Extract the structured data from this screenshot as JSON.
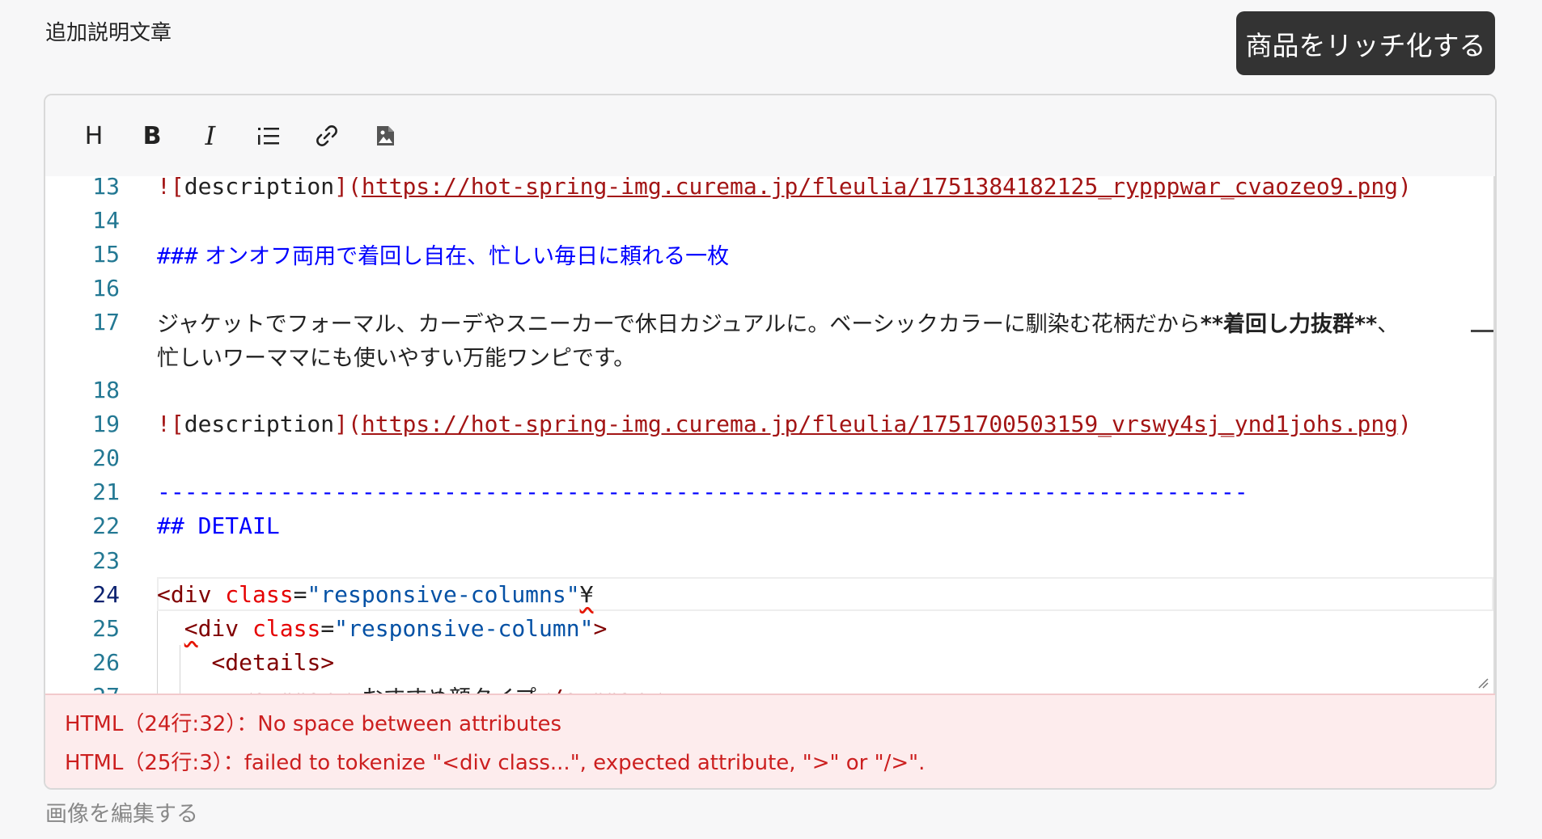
{
  "section_label": "追加説明文章",
  "rich_button_label": "商品をリッチ化する",
  "toolbar": {
    "heading": "H",
    "bold": "B",
    "italic": "I",
    "list_icon": "list-icon",
    "link_icon": "link-icon",
    "image_icon": "image-icon"
  },
  "lines": [
    {
      "n": "13",
      "parts": [
        [
          "red",
          "!["
        ],
        [
          "",
          "description"
        ],
        [
          "red",
          "]("
        ],
        [
          "link",
          "https://hot-spring-img.curema.jp/fleulia/1751384182125_rypppwar_cvaozeo9.png"
        ],
        [
          "red",
          ")"
        ]
      ]
    },
    {
      "n": "14",
      "parts": []
    },
    {
      "n": "15",
      "parts": [
        [
          "blue",
          "###"
        ],
        [
          "blue jp",
          " オンオフ両用で着回し自在、忙しい毎日に頼れる一枚"
        ]
      ]
    },
    {
      "n": "16",
      "parts": []
    },
    {
      "n": "17",
      "parts": [
        [
          "jp",
          "ジャケットでフォーマル、カーデやスニーカーで休日カジュアルに。ベーシックカラーに馴染む花柄だから"
        ],
        [
          "jp bold",
          "**着回し力抜群**"
        ],
        [
          "jp",
          "、"
        ]
      ]
    },
    {
      "n": "",
      "parts": [
        [
          "jp",
          "忙しいワーママにも使いやすい万能ワンピです。"
        ]
      ]
    },
    {
      "n": "18",
      "parts": []
    },
    {
      "n": "19",
      "parts": [
        [
          "red",
          "!["
        ],
        [
          "",
          "description"
        ],
        [
          "red",
          "]("
        ],
        [
          "link",
          "https://hot-spring-img.curema.jp/fleulia/1751700503159_vrswy4sj_ynd1johs.png"
        ],
        [
          "red",
          ")"
        ]
      ]
    },
    {
      "n": "20",
      "parts": []
    },
    {
      "n": "21",
      "parts": [
        [
          "blue",
          "--------------------------------------------------------------------------------"
        ]
      ]
    },
    {
      "n": "22",
      "parts": [
        [
          "blue",
          "## DETAIL"
        ]
      ]
    },
    {
      "n": "23",
      "parts": []
    },
    {
      "n": "24",
      "parts": [
        [
          "dkred",
          "<div"
        ],
        [
          "",
          " "
        ],
        [
          "attr",
          "class"
        ],
        [
          "",
          "="
        ],
        [
          "str",
          "\"responsive-columns\""
        ],
        [
          "squig",
          "¥"
        ]
      ]
    },
    {
      "n": "25",
      "parts": [
        [
          "",
          "  "
        ],
        [
          "dkred squig",
          "<"
        ],
        [
          "dkred",
          "div"
        ],
        [
          "",
          " "
        ],
        [
          "attr",
          "class"
        ],
        [
          "",
          "="
        ],
        [
          "str",
          "\"responsive-column\""
        ],
        [
          "dkred",
          ">"
        ]
      ]
    },
    {
      "n": "26",
      "parts": [
        [
          "",
          "    "
        ],
        [
          "dkred",
          "<details>"
        ]
      ]
    },
    {
      "n": "27",
      "parts": [
        [
          "",
          "      "
        ],
        [
          "dkred",
          "<summary>"
        ],
        [
          "jp",
          "おすすめ顔タイプ"
        ],
        [
          "dkred",
          "</summary>"
        ]
      ]
    }
  ],
  "active_line": "24",
  "errors": [
    "HTML（24行:32）：No space between attributes",
    "HTML（25行:3）：failed to tokenize \"<div class...\", expected attribute, \">\" or \"/>\"."
  ],
  "edit_image_label": "画像を編集する"
}
